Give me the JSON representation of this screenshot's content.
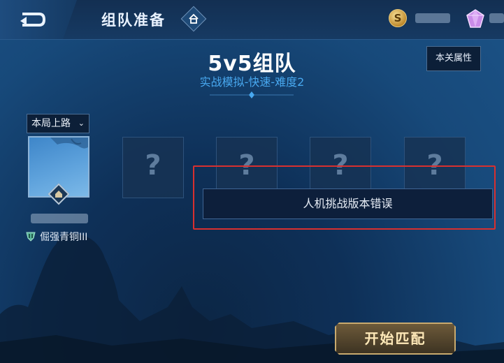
{
  "header": {
    "title": "组队准备",
    "coin_symbol": "S"
  },
  "mode": {
    "title": "5v5组队",
    "subtitle": "实战模拟-快速-难度2",
    "level_attr_label": "本关属性"
  },
  "player": {
    "lane_label": "本局上路",
    "rank": "倔强青铜III"
  },
  "error_message": "人机挑战版本错误",
  "start_button_label": "开始匹配",
  "empty_slot_symbol": "?",
  "colors": {
    "accent_blue": "#48a8ef",
    "highlight_red": "#d8302f",
    "gold_border": "#c9aa6e"
  }
}
